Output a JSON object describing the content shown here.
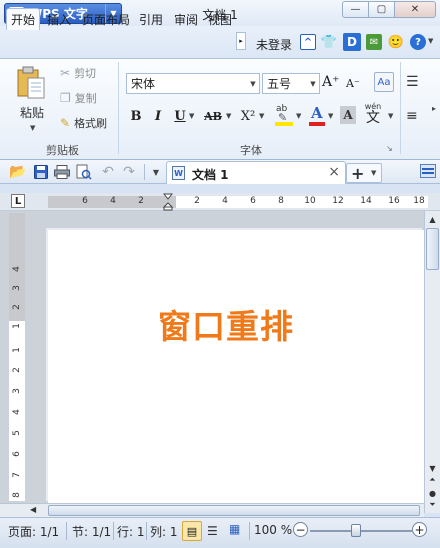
{
  "app": {
    "menu_label": "WPS 文字",
    "logo": "W",
    "doc_title": "文档 1"
  },
  "window_buttons": {
    "minimize": "—",
    "maximize": "▢",
    "close": "✕"
  },
  "tabs": [
    {
      "label": "开始",
      "active": true
    },
    {
      "label": "插入"
    },
    {
      "label": "页面布局"
    },
    {
      "label": "引用"
    },
    {
      "label": "审阅"
    },
    {
      "label": "视图"
    }
  ],
  "tab_overflow": "▸",
  "login": "未登录",
  "clipboard": {
    "paste": "粘贴",
    "cut": "剪切",
    "copy": "复制",
    "format_painter": "格式刷",
    "group": "剪贴板"
  },
  "font": {
    "family": "宋体",
    "size": "五号",
    "group": "字体",
    "bold": "B",
    "italic": "I",
    "underline": "U",
    "strikethrough": "AB",
    "superscript": "X²",
    "highlight": "ab",
    "color": "A",
    "shade": "A",
    "phonetic": "wén",
    "phonetic_char": "文",
    "grow": "A⁺",
    "shrink": "A⁻"
  },
  "doc_tab": {
    "label": "文档 1",
    "close": "×"
  },
  "add_tab": "+",
  "ruler": {
    "h_numbers": [
      "6",
      "4",
      "2",
      "2",
      "4",
      "6",
      "8",
      "10",
      "12",
      "14",
      "16",
      "18"
    ],
    "v_numbers": [
      "4",
      "3",
      "2",
      "1",
      "1",
      "2",
      "3",
      "4",
      "5",
      "6",
      "7",
      "8"
    ]
  },
  "document": {
    "heading": "窗口重排"
  },
  "status": {
    "page": "页面: 1/1",
    "section": "节: 1/1",
    "row": "行: 1",
    "column": "列: 1",
    "zoom": "100 %",
    "zoom_fraction": 0.45
  },
  "colors": {
    "accent": "#2a5fc2",
    "heading": "#f07a1a",
    "font_color_bar": "#e02020",
    "highlight_bar": "#ffe600"
  }
}
